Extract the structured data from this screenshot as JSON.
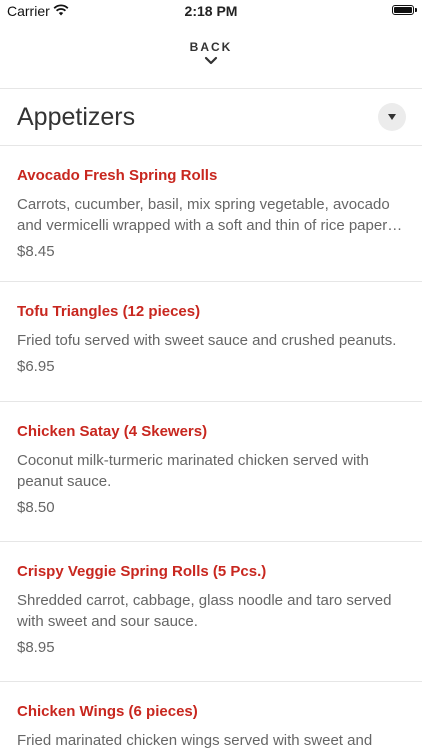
{
  "status_bar": {
    "carrier": "Carrier",
    "time": "2:18 PM"
  },
  "nav": {
    "back_label": "BACK"
  },
  "section": {
    "title": "Appetizers"
  },
  "items": [
    {
      "name": "Avocado Fresh Spring Rolls",
      "description": "Carrots, cucumber, basil, mix spring vegetable, avocado and vermicelli wrapped with a soft and thin of rice paper…",
      "price": "$8.45"
    },
    {
      "name": "Tofu Triangles (12 pieces)",
      "description": "Fried tofu served with sweet sauce and crushed peanuts.",
      "price": "$6.95"
    },
    {
      "name": "Chicken Satay (4 Skewers)",
      "description": "Coconut milk-turmeric marinated chicken served with peanut sauce.",
      "price": "$8.50"
    },
    {
      "name": "Crispy Veggie Spring Rolls (5 Pcs.)",
      "description": "Shredded carrot, cabbage, glass noodle and taro served with sweet and sour sauce.",
      "price": "$8.95"
    },
    {
      "name": "Chicken Wings (6 pieces)",
      "description": "Fried marinated chicken wings served with sweet and",
      "price": ""
    }
  ],
  "colors": {
    "accent": "#c8271f",
    "text_secondary": "#666666",
    "divider": "#e6e6e6"
  },
  "icons": {
    "wifi": "wifi-icon",
    "battery": "battery-icon",
    "back": "chevron-down-icon",
    "collapse": "triangle-down-icon"
  }
}
